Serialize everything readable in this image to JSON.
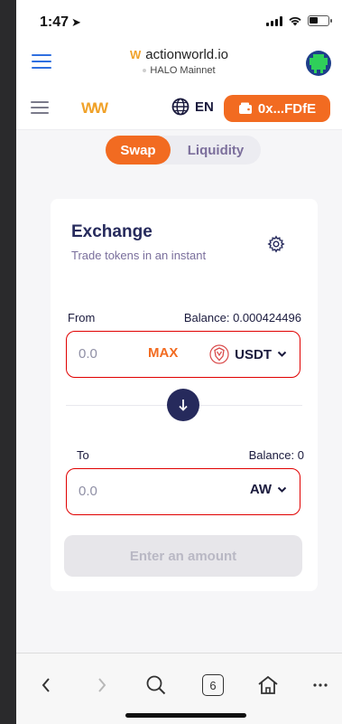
{
  "status_bar": {
    "time": "1:47"
  },
  "browser_header": {
    "domain": "actionworld.io",
    "network": "HALO Mainnet"
  },
  "dapp_nav": {
    "language": "EN",
    "wallet_address": "0x...FDfE"
  },
  "tabs": [
    {
      "label": "Swap",
      "active": true
    },
    {
      "label": "Liquidity",
      "active": false
    }
  ],
  "exchange": {
    "title": "Exchange",
    "subtitle": "Trade tokens in an instant",
    "from": {
      "label": "From",
      "balance": "Balance: 0.000424496",
      "amount_placeholder": "0.0",
      "max_label": "MAX",
      "token": "USDT"
    },
    "to": {
      "label": "To",
      "balance": "Balance: 0",
      "amount_placeholder": "0.0",
      "token": "AW"
    },
    "submit_label": "Enter an amount"
  },
  "browser_toolbar": {
    "tab_count": "6"
  },
  "colors": {
    "accent": "#f26b21",
    "title": "#262a5c",
    "highlight_border": "#e00000"
  }
}
